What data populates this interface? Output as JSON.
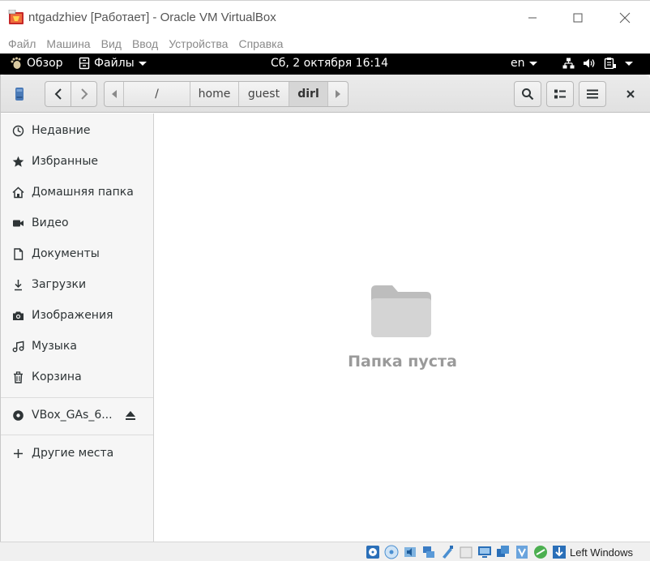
{
  "window": {
    "title": "ntgadzhiev [Работает] - Oracle VM VirtualBox",
    "app_icon": "virtualbox-icon",
    "controls": [
      "minimize-icon",
      "maximize-icon",
      "close-icon"
    ]
  },
  "vbox_menu": {
    "items": [
      "Файл",
      "Машина",
      "Вид",
      "Ввод",
      "Устройства",
      "Справка"
    ]
  },
  "gnome_bar": {
    "activities": "Обзор",
    "app_menu": "Файлы",
    "clock": "Сб, 2 октября  16:14",
    "lang": "en"
  },
  "headerbar": {
    "path": [
      "/",
      "home",
      "guest",
      "dirl"
    ],
    "active_segment": "dirl"
  },
  "sidebar": {
    "items": [
      {
        "label": "Недавние",
        "icon": "clock-icon"
      },
      {
        "label": "Избранные",
        "icon": "star-icon"
      },
      {
        "label": "Домашняя папка",
        "icon": "home-icon"
      },
      {
        "label": "Видео",
        "icon": "video-icon"
      },
      {
        "label": "Документы",
        "icon": "document-icon"
      },
      {
        "label": "Загрузки",
        "icon": "download-icon"
      },
      {
        "label": "Изображения",
        "icon": "camera-icon"
      },
      {
        "label": "Музыка",
        "icon": "music-icon"
      },
      {
        "label": "Корзина",
        "icon": "trash-icon"
      }
    ],
    "device": {
      "label": "VBox_GAs_6...",
      "icon": "disc-icon"
    },
    "other": {
      "label": "Другие места",
      "icon": "plus-icon"
    }
  },
  "content": {
    "empty_message": "Папка пуста"
  },
  "status_bar": {
    "host_key": "Left Windows"
  }
}
